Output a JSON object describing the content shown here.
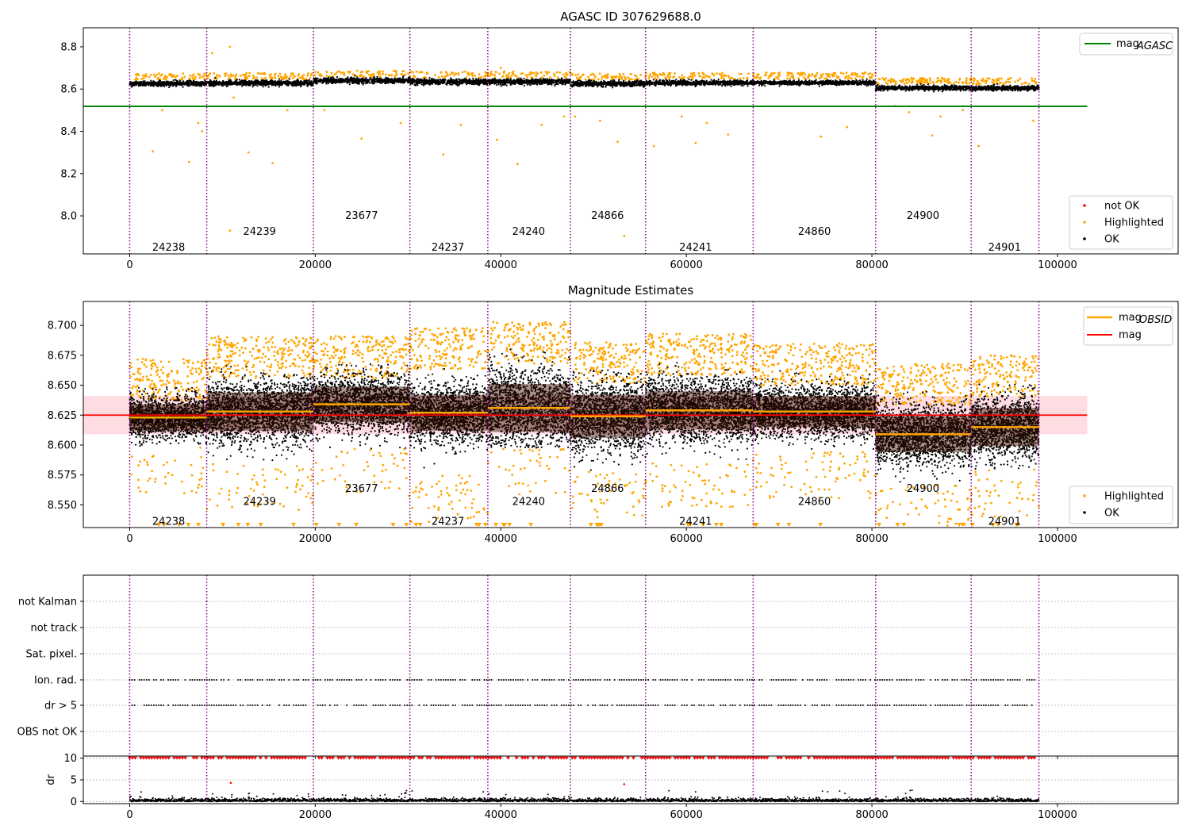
{
  "colors": {
    "ok": "#000000",
    "highlighted": "#ffa500",
    "not_ok": "#ff0000",
    "agasc_line": "#008000",
    "mag_line": "#ff0000",
    "mag_band": "#ffc0cb",
    "obsid_line": "#ffa500",
    "obsid_divider": "#800080",
    "grid": "#b0b0b0"
  },
  "chart_data": [
    {
      "id": "agasc",
      "type": "scatter",
      "title": "AGASC ID 307629688.0",
      "xlim": [
        -5000,
        113000
      ],
      "ylim": [
        7.82,
        8.89
      ],
      "yticks": [
        8.0,
        8.2,
        8.4,
        8.6,
        8.8
      ],
      "ytick_labels": [
        "8.0",
        "8.2",
        "8.4",
        "8.6",
        "8.8"
      ],
      "xticks": [
        0,
        20000,
        40000,
        60000,
        80000,
        100000
      ],
      "xtick_labels": [
        "0",
        "20000",
        "40000",
        "60000",
        "80000",
        "100000"
      ],
      "obsid_boundaries": [
        0,
        8300,
        19800,
        30200,
        38600,
        47500,
        55600,
        67200,
        80400,
        90700,
        98000
      ],
      "obsids": [
        {
          "label": "24238",
          "x": 4200,
          "y": 7.85
        },
        {
          "label": "24239",
          "x": 14000,
          "y": 7.925
        },
        {
          "label": "23677",
          "x": 25000,
          "y": 8.0
        },
        {
          "label": "24237",
          "x": 34300,
          "y": 7.85
        },
        {
          "label": "24240",
          "x": 43000,
          "y": 7.925
        },
        {
          "label": "24866",
          "x": 51500,
          "y": 8.0
        },
        {
          "label": "24241",
          "x": 61000,
          "y": 7.85
        },
        {
          "label": "24860",
          "x": 73800,
          "y": 7.925
        },
        {
          "label": "24900",
          "x": 85500,
          "y": 8.0
        },
        {
          "label": "24901",
          "x": 94300,
          "y": 7.85
        }
      ],
      "agasc_mag": 8.518,
      "agasc_xrange": [
        -5000,
        103200
      ],
      "segments": [
        {
          "mean": 8.626,
          "spread": 0.008
        },
        {
          "mean": 8.628,
          "spread": 0.009
        },
        {
          "mean": 8.64,
          "spread": 0.009
        },
        {
          "mean": 8.635,
          "spread": 0.009
        },
        {
          "mean": 8.635,
          "spread": 0.009
        },
        {
          "mean": 8.625,
          "spread": 0.009
        },
        {
          "mean": 8.63,
          "spread": 0.008
        },
        {
          "mean": 8.63,
          "spread": 0.007
        },
        {
          "mean": 8.605,
          "spread": 0.008
        },
        {
          "mean": 8.605,
          "spread": 0.008
        }
      ],
      "highlighted_outliers": [
        [
          2500,
          8.305
        ],
        [
          6400,
          8.255
        ],
        [
          7400,
          8.44
        ],
        [
          8900,
          8.77
        ],
        [
          10800,
          8.8
        ],
        [
          12800,
          8.3
        ],
        [
          15400,
          8.25
        ],
        [
          10800,
          7.93
        ],
        [
          3500,
          8.5
        ],
        [
          7800,
          8.4
        ],
        [
          11200,
          8.56
        ],
        [
          17000,
          8.5
        ],
        [
          25000,
          8.365
        ],
        [
          33800,
          8.29
        ],
        [
          35700,
          8.43
        ],
        [
          39600,
          8.36
        ],
        [
          41800,
          8.245
        ],
        [
          44400,
          8.43
        ],
        [
          46800,
          8.47
        ],
        [
          50700,
          8.45
        ],
        [
          52600,
          8.35
        ],
        [
          53300,
          7.905
        ],
        [
          56500,
          8.33
        ],
        [
          59500,
          8.47
        ],
        [
          61000,
          8.345
        ],
        [
          62200,
          8.44
        ],
        [
          64500,
          8.385
        ],
        [
          74500,
          8.375
        ],
        [
          77300,
          8.42
        ],
        [
          82500,
          8.52
        ],
        [
          84000,
          8.49
        ],
        [
          86500,
          8.38
        ],
        [
          87400,
          8.47
        ],
        [
          89800,
          8.5
        ],
        [
          91500,
          8.33
        ],
        [
          97400,
          8.45
        ],
        [
          29200,
          8.44
        ],
        [
          40000,
          8.7
        ],
        [
          21000,
          8.5
        ],
        [
          48000,
          8.47
        ]
      ],
      "legend_top": [
        {
          "label": "mag",
          "sub": "AGASC",
          "kind": "line",
          "color": "#008000"
        }
      ],
      "legend_bottom": [
        {
          "label": "not OK",
          "color": "#ff0000"
        },
        {
          "label": "Highlighted",
          "color": "#ffa500"
        },
        {
          "label": "OK",
          "color": "#000000"
        }
      ]
    },
    {
      "id": "estimates",
      "type": "scatter",
      "title": "Magnitude Estimates",
      "xlim": [
        -5000,
        113000
      ],
      "ylim": [
        8.531,
        8.72
      ],
      "yticks": [
        8.55,
        8.575,
        8.6,
        8.625,
        8.65,
        8.675,
        8.7
      ],
      "ytick_labels": [
        "8.550",
        "8.575",
        "8.600",
        "8.625",
        "8.650",
        "8.675",
        "8.700"
      ],
      "xticks": [
        0,
        20000,
        40000,
        60000,
        80000,
        100000
      ],
      "xtick_labels": [
        "0",
        "20000",
        "40000",
        "60000",
        "80000",
        "100000"
      ],
      "obsids": [
        {
          "label": "24238",
          "x": 4200,
          "y": 8.536
        },
        {
          "label": "24239",
          "x": 14000,
          "y": 8.5525
        },
        {
          "label": "23677",
          "x": 25000,
          "y": 8.5635
        },
        {
          "label": "24237",
          "x": 34300,
          "y": 8.536
        },
        {
          "label": "24240",
          "x": 43000,
          "y": 8.5525
        },
        {
          "label": "24866",
          "x": 51500,
          "y": 8.5635
        },
        {
          "label": "24241",
          "x": 61000,
          "y": 8.536
        },
        {
          "label": "24860",
          "x": 73800,
          "y": 8.5525
        },
        {
          "label": "24900",
          "x": 85500,
          "y": 8.5635
        },
        {
          "label": "24901",
          "x": 94300,
          "y": 8.536
        }
      ],
      "mag": 8.625,
      "mag_band": [
        8.609,
        8.641
      ],
      "mag_xrange": [
        -5000,
        103200
      ],
      "obsid_mags": [
        8.623,
        8.628,
        8.634,
        8.627,
        8.631,
        8.624,
        8.629,
        8.628,
        8.609,
        8.615
      ],
      "obsid_stds": [
        0.011,
        0.016,
        0.015,
        0.015,
        0.02,
        0.018,
        0.016,
        0.013,
        0.015,
        0.016
      ],
      "segment_ranges": [
        [
          8.598,
          8.649
        ],
        [
          8.585,
          8.668
        ],
        [
          8.597,
          8.668
        ],
        [
          8.575,
          8.675
        ],
        [
          8.598,
          8.68
        ],
        [
          8.578,
          8.663
        ],
        [
          8.588,
          8.67
        ],
        [
          8.595,
          8.662
        ],
        [
          8.568,
          8.645
        ],
        [
          8.58,
          8.652
        ]
      ],
      "legend_top": [
        {
          "label": "mag",
          "sub": "OBSID",
          "kind": "line",
          "color": "#ffa500"
        },
        {
          "label": "mag",
          "sub": "",
          "kind": "line",
          "color": "#ff0000"
        }
      ],
      "legend_bottom": [
        {
          "label": "Highlighted",
          "color": "#ffa500"
        },
        {
          "label": "OK",
          "color": "#000000"
        }
      ]
    },
    {
      "id": "flags",
      "type": "scatter",
      "title": "",
      "xlim": [
        -5000,
        113000
      ],
      "categories": [
        "not Kalman",
        "not track",
        "Sat. pixel.",
        "Ion. rad.",
        "dr > 5",
        "OBS not OK"
      ]
    },
    {
      "id": "dr",
      "type": "scatter",
      "title": "",
      "xlim": [
        -5000,
        113000
      ],
      "ylim": [
        -0.5,
        10.5
      ],
      "yticks": [
        0,
        5,
        10
      ],
      "ytick_labels": [
        "0",
        "5",
        "10"
      ],
      "ylabel": "dr",
      "xticks": [
        0,
        20000,
        40000,
        60000,
        80000,
        100000
      ],
      "xtick_labels": [
        "0",
        "20000",
        "40000",
        "60000",
        "80000",
        "100000"
      ],
      "clip_value": 10
    }
  ]
}
